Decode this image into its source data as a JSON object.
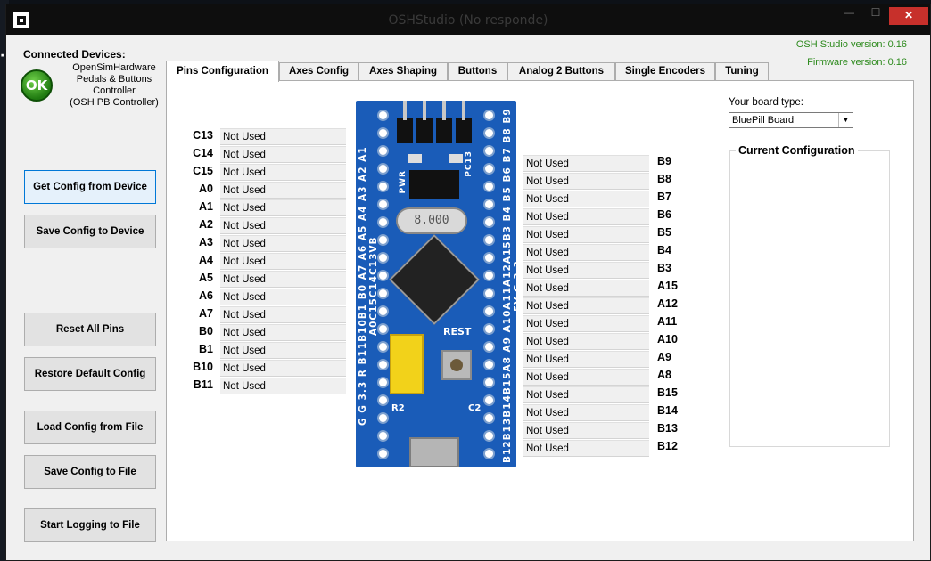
{
  "window": {
    "title": "OSHStudio (No responde)",
    "close_label": "✕",
    "min_label": "—",
    "max_label": "☐"
  },
  "left": {
    "connected_label": "Connected Devices:",
    "ok_label": "OK",
    "device_name": "OpenSimHardware\nPedals & Buttons\nController\n(OSH PB Controller)",
    "buttons": [
      "Get Config from Device",
      "Save Config to Device",
      "Reset All Pins",
      "Restore Default Config",
      "Load Config from File",
      "Save Config to File",
      "Start Logging to File"
    ]
  },
  "versions": {
    "osh_studio": "OSH Studio version: 0.16",
    "firmware": "Firmware version: 0.16"
  },
  "tabs": [
    "Pins Configuration",
    "Axes Config",
    "Axes Shaping",
    "Buttons",
    "Analog 2 Buttons",
    "Single Encoders",
    "Tuning"
  ],
  "left_pins": [
    {
      "label": "C13",
      "value": "Not Used"
    },
    {
      "label": "C14",
      "value": "Not Used"
    },
    {
      "label": "C15",
      "value": "Not Used"
    },
    {
      "label": "A0",
      "value": "Not Used"
    },
    {
      "label": "A1",
      "value": "Not Used"
    },
    {
      "label": "A2",
      "value": "Not Used"
    },
    {
      "label": "A3",
      "value": "Not Used"
    },
    {
      "label": "A4",
      "value": "Not Used"
    },
    {
      "label": "A5",
      "value": "Not Used"
    },
    {
      "label": "A6",
      "value": "Not Used"
    },
    {
      "label": "A7",
      "value": "Not Used"
    },
    {
      "label": "B0",
      "value": "Not Used"
    },
    {
      "label": "B1",
      "value": "Not Used"
    },
    {
      "label": "B10",
      "value": "Not Used"
    },
    {
      "label": "B11",
      "value": "Not Used"
    }
  ],
  "right_pins": [
    {
      "label": "B9",
      "value": "Not Used"
    },
    {
      "label": "B8",
      "value": "Not Used"
    },
    {
      "label": "B7",
      "value": "Not Used"
    },
    {
      "label": "B6",
      "value": "Not Used"
    },
    {
      "label": "B5",
      "value": "Not Used"
    },
    {
      "label": "B4",
      "value": "Not Used"
    },
    {
      "label": "B3",
      "value": "Not Used"
    },
    {
      "label": "A15",
      "value": "Not Used"
    },
    {
      "label": "A12",
      "value": "Not Used"
    },
    {
      "label": "A11",
      "value": "Not Used"
    },
    {
      "label": "A10",
      "value": "Not Used"
    },
    {
      "label": "A9",
      "value": "Not Used"
    },
    {
      "label": "A8",
      "value": "Not Used"
    },
    {
      "label": "B15",
      "value": "Not Used"
    },
    {
      "label": "B14",
      "value": "Not Used"
    },
    {
      "label": "B13",
      "value": "Not Used"
    },
    {
      "label": "B12",
      "value": "Not Used"
    }
  ],
  "board": {
    "type_label": "Your board type:",
    "selected": "BluePill Board",
    "silk_left": "G G 3.3 R B11B10B1 B0 A7 A6 A5 A4 A3 A2 A1 A0C15C14C13VB",
    "silk_right": "B12B13B14B15A8 A9 A10A11A12A15B3 B4 B5 B6 B7 B8 B9 5V G 3.3",
    "crystal_text": "8.000",
    "reset_text": "REST",
    "pwr_text": "PWR",
    "pc13_text": "PC13",
    "r2_text": "R2",
    "c2_text": "C2"
  },
  "current_config": {
    "title": "Current Configuration"
  },
  "colors": {
    "ok_green": "#2a9a1c",
    "version_green": "#2d8a1d",
    "board_blue": "#1a5cb8",
    "close_red": "#c7302b"
  },
  "icons": {
    "app": "app-icon",
    "ok": "ok-status-icon",
    "dropdown": "chevron-down-icon"
  }
}
